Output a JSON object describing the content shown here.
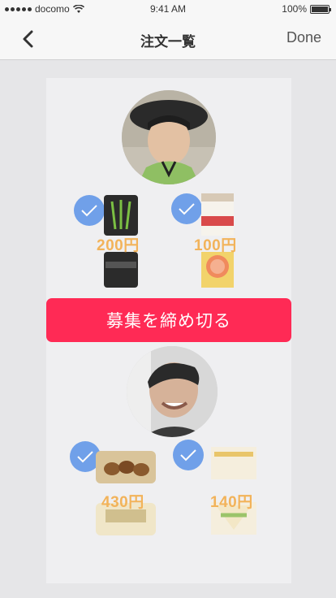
{
  "status_bar": {
    "carrier": "docomo",
    "time": "9:41 AM",
    "battery": "100%"
  },
  "nav": {
    "title": "注文一覧",
    "done_label": "Done"
  },
  "orders": [
    {
      "items": [
        {
          "product": "monster-energy-can",
          "price": "200円",
          "checked": true
        },
        {
          "product": "grapefruit-juice-carton",
          "price": "100円",
          "checked": true
        }
      ]
    },
    {
      "items": [
        {
          "product": "roasted-chestnuts-pack",
          "price": "430円",
          "checked": true
        },
        {
          "product": "sandwich-pack",
          "price": "140円",
          "checked": true
        }
      ]
    }
  ],
  "close_button": {
    "label": "募集を締め切る",
    "color": "#ff2a55"
  },
  "colors": {
    "price": "#f2b35a",
    "check": "#5b93e8"
  }
}
